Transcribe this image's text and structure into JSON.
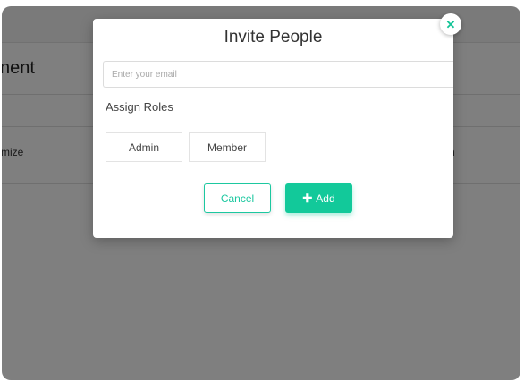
{
  "background_page": {
    "title_fragment": "nent",
    "row_left_fragment": "mize",
    "row_right_fragment": "n"
  },
  "modal": {
    "title": "Invite People",
    "email_placeholder": "Enter your email",
    "email_value": "",
    "roles_label": "Assign Roles",
    "roles": [
      "Admin",
      "Member"
    ],
    "cancel_label": "Cancel",
    "add_label": "Add",
    "add_icon": "plus-icon",
    "close_icon": "close-icon"
  },
  "colors": {
    "accent": "#12c99a",
    "overlay": "rgba(0,0,0,0.5)"
  }
}
